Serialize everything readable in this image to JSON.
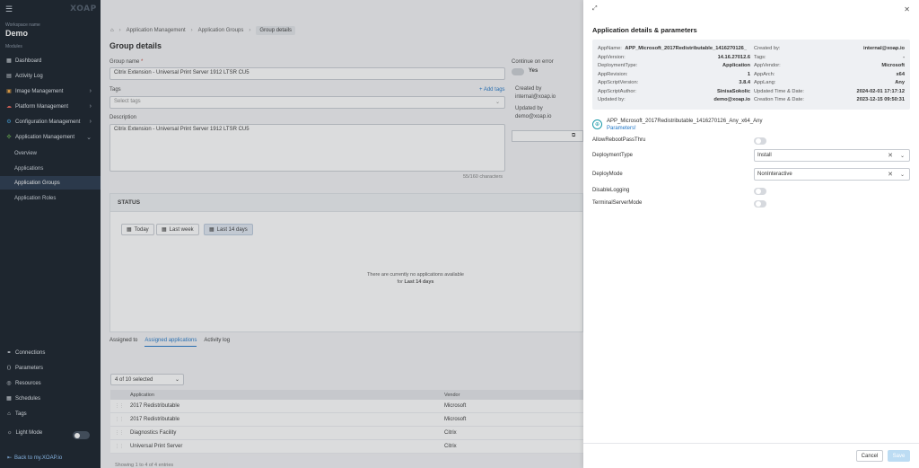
{
  "sidebar": {
    "logo": "XOAP",
    "workspace_label": "Workspace name",
    "workspace_name": "Demo",
    "modules_label": "Modules",
    "items": [
      {
        "label": "Dashboard"
      },
      {
        "label": "Activity Log"
      },
      {
        "label": "Image Management"
      },
      {
        "label": "Platform Management"
      },
      {
        "label": "Configuration Management"
      },
      {
        "label": "Application Management"
      }
    ],
    "sub_items": [
      {
        "label": "Overview"
      },
      {
        "label": "Applications"
      },
      {
        "label": "Application Groups"
      },
      {
        "label": "Application Roles"
      }
    ],
    "bottom_items": [
      {
        "label": "Connections"
      },
      {
        "label": "Parameters"
      },
      {
        "label": "Resources"
      },
      {
        "label": "Schedules"
      },
      {
        "label": "Tags"
      }
    ],
    "light_mode": "Light Mode",
    "back_link": "Back to my.XOAP.io"
  },
  "main": {
    "breadcrumb": [
      "Application Management",
      "Application Groups",
      "Group details"
    ],
    "title": "Group details",
    "group_name_label": "Group name",
    "group_name_value": "Citrix Extension - Universal Print Server 1912 LTSR CU5",
    "tags_label": "Tags",
    "add_tags": "Add tags",
    "tags_placeholder": "Select tags",
    "description_label": "Description",
    "description_value": "Citrix Extension - Universal Print Server 1912 LTSR CU5",
    "char_count": "55/160 characters",
    "continue_label": "Continue on error",
    "continue_value": "Yes",
    "created_by_label": "Created by",
    "created_by_value": "internal@xoap.io",
    "updated_by_label": "Updated by",
    "updated_by_value": "demo@xoap.io",
    "status_title": "STATUS",
    "filters": [
      "Today",
      "Last week",
      "Last 14 days"
    ],
    "empty_line1": "There are currently no applications available",
    "empty_line2_prefix": "for",
    "empty_line2_bold": "Last 14 days",
    "tabs": [
      "Assigned to",
      "Assigned applications",
      "Activity log"
    ],
    "selected_count": "4 of 10 selected",
    "columns": [
      "Application",
      "Vendor"
    ],
    "rows": [
      {
        "application": "2017 Redistributable",
        "vendor": "Microsoft"
      },
      {
        "application": "2017 Redistributable",
        "vendor": "Microsoft"
      },
      {
        "application": "Diagnostics Facility",
        "vendor": "Citrix"
      },
      {
        "application": "Universal Print Server",
        "vendor": "Citrix"
      }
    ],
    "footer": "Showing 1 to 4 of 4 entries"
  },
  "drawer": {
    "title": "Application details & parameters",
    "info_left": [
      {
        "k": "AppName:",
        "v": "APP_Microsoft_2017Redistributable_1416270126_"
      },
      {
        "k": "AppVersion:",
        "v": "14.16.27012.6"
      },
      {
        "k": "DeploymentType:",
        "v": "Application"
      },
      {
        "k": "AppRevision:",
        "v": "1"
      },
      {
        "k": "AppScriptVersion:",
        "v": "3.8.4"
      },
      {
        "k": "AppScriptAuthor:",
        "v": "SinisaSokolic"
      },
      {
        "k": "Updated by:",
        "v": "demo@xoap.io"
      }
    ],
    "info_right": [
      {
        "k": "Created by:",
        "v": "internal@xoap.io"
      },
      {
        "k": "Tags:",
        "v": "-"
      },
      {
        "k": "AppVendor:",
        "v": "Microsoft"
      },
      {
        "k": "AppArch:",
        "v": "x64"
      },
      {
        "k": "AppLang:",
        "v": "Any"
      },
      {
        "k": "Updated Time & Date:",
        "v": "2024-02-01 17:17:12"
      },
      {
        "k": "Creation Time & Date:",
        "v": "2023-12-15 09:50:31"
      }
    ],
    "app_full_name": "APP_Microsoft_2017Redistributable_1416270126_Any_x64_Any",
    "parameters_link": "Parameters!",
    "params": {
      "allow_reboot": "AllowRebootPassThru",
      "deployment_type": "DeploymentType",
      "deployment_type_value": "Install",
      "deploy_mode": "DeployMode",
      "deploy_mode_value": "NonInteractive",
      "disable_logging": "DisableLogging",
      "terminal_server": "TerminalServerMode"
    },
    "cancel": "Cancel",
    "save": "Save"
  }
}
